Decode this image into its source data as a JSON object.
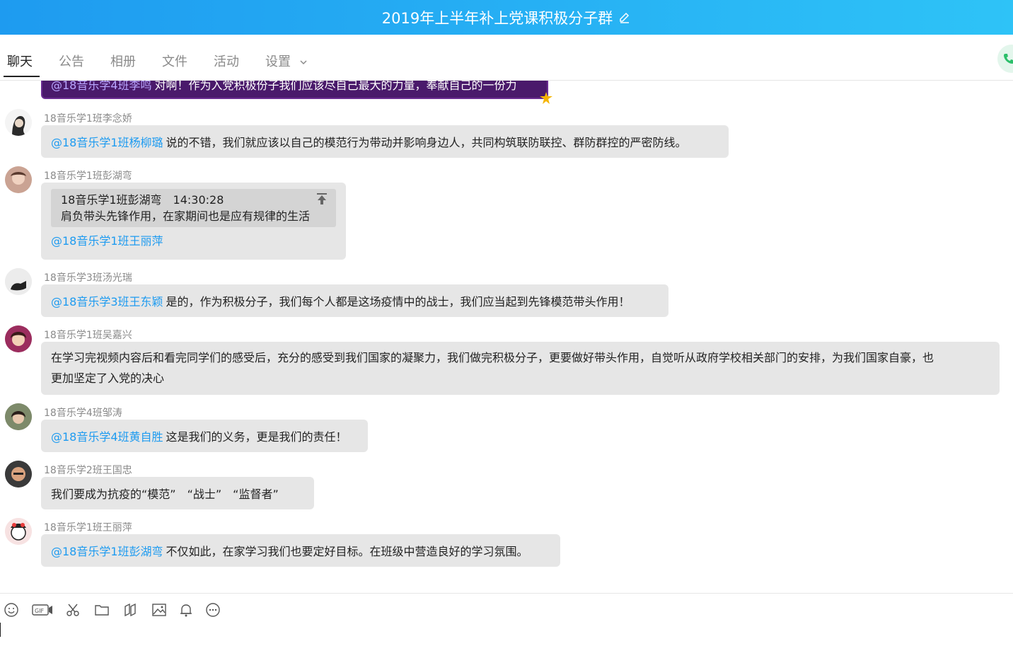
{
  "window": {
    "title": "2019年上半年补上党课积极分子群"
  },
  "tabs": [
    {
      "label": "聊天"
    },
    {
      "label": "公告"
    },
    {
      "label": "相册"
    },
    {
      "label": "文件"
    },
    {
      "label": "活动"
    },
    {
      "label": "设置"
    }
  ],
  "messages": [
    {
      "mention": "@18音乐学4班李鸣",
      "text": "对啊！作为入党积极份子我们应该尽自己最大的力量，奉献自己的一份力"
    },
    {
      "sender": "18音乐学1班李念娇",
      "mention": "@18音乐学1班杨柳璐",
      "text": "说的不错，我们就应该以自己的模范行为带动并影响身边人，共同构筑联防联控、群防群控的严密防线。"
    },
    {
      "sender": "18音乐学1班彭湖弯",
      "quote_header": "18音乐学1班彭湖弯　14:30:28",
      "quote_text": "肩负带头先锋作用，在家期间也是应有规律的生活",
      "mention": "@18音乐学1班王丽萍"
    },
    {
      "sender": "18音乐学3班汤光瑞",
      "mention": "@18音乐学3班王东颖",
      "text": "是的，作为积极分子，我们每个人都是这场疫情中的战士，我们应当起到先锋模范带头作用！"
    },
    {
      "sender": "18音乐学1班吴嘉兴",
      "text_line1": "在学习完视频内容后和看完同学们的感受后，充分的感受到我们国家的凝聚力，我们做完积极分子，更要做好带头作用，自觉听从政府学校相关部门的安排，为我们国家自豪，也",
      "text_line2": "更加坚定了入党的决心"
    },
    {
      "sender": "18音乐学4班邹涛",
      "mention": "@18音乐学4班黄自胜",
      "text": "这是我们的义务，更是我们的责任！"
    },
    {
      "sender": "18音乐学2班王国忠",
      "text": "我们要成为抗疫的“模范”　“战士”　“监督者”"
    },
    {
      "sender": "18音乐学1班王丽萍",
      "mention": "@18音乐学1班彭湖弯",
      "text": "不仅如此，在家学习我们也要定好目标。在班级中营造良好的学习氛围。"
    }
  ],
  "toolbar": {
    "icons": [
      "emoji-icon",
      "gif-icon",
      "scissors-icon",
      "folder-icon",
      "sticker-icon",
      "image-icon",
      "bell-icon",
      "more-icon"
    ]
  },
  "colors": {
    "accent": "#1e9bf0",
    "bubble": "#e6e6e6",
    "title_gradient_start": "#1e9bf0",
    "title_gradient_end": "#2ec3f7"
  }
}
